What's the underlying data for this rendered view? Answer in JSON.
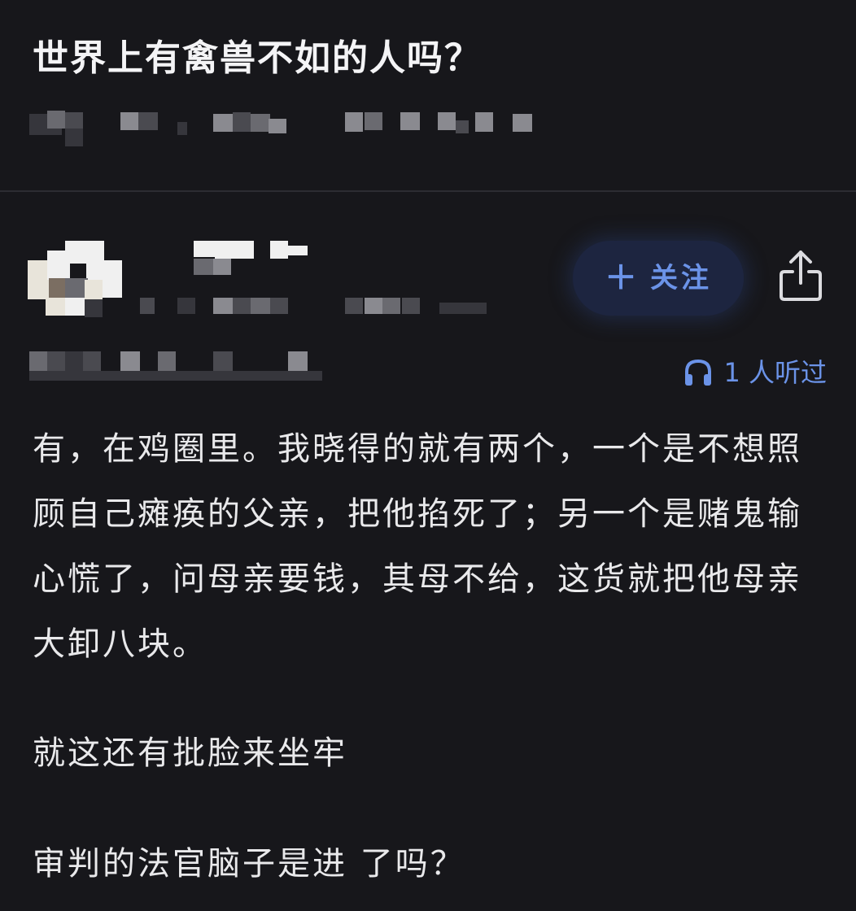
{
  "question": {
    "title": "世界上有禽兽不如的人吗？"
  },
  "author": {
    "follow_label": "关注",
    "follow_icon": "plus-icon",
    "share_icon": "share-icon"
  },
  "listen": {
    "icon": "headphone-icon",
    "count_text": "1 人听过"
  },
  "answer": {
    "paragraphs": [
      "有，在鸡圈里。我晓得的就有两个，一个是不想照顾自己瘫痪的父亲，把他掐死了；另一个是赌鬼输心慌了，问母亲要钱，其母不给，这货就把他母亲大卸八块。",
      "就这还有批脸来坐牢",
      "审判的法官脑子是进 了吗？"
    ]
  },
  "colors": {
    "background": "#17171b",
    "accent": "#6b93e8",
    "text": "#e9e9eb",
    "follow_button_bg": "#1d2540"
  }
}
